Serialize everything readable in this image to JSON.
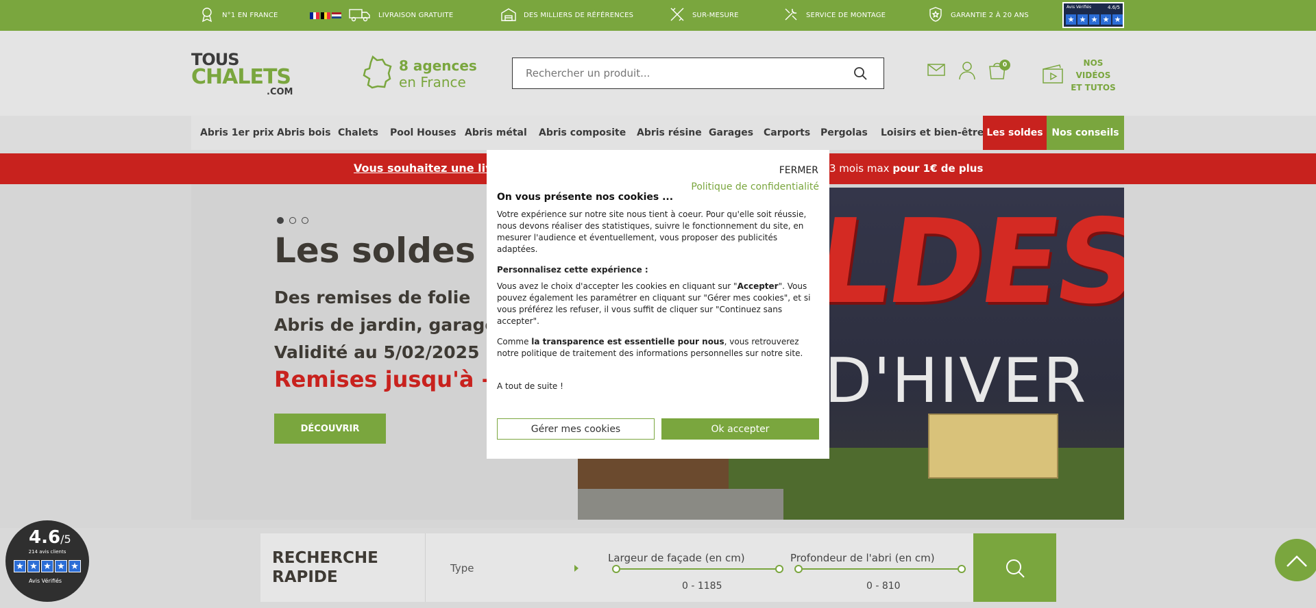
{
  "topbar": {
    "items": [
      {
        "label": "N°1 EN FRANCE",
        "icon": "ribbon-icon"
      },
      {
        "label": "LIVRAISON GRATUITE",
        "icon": "truck-icon"
      },
      {
        "label": "DES MILLIERS DE RÉFÉRENCES",
        "icon": "warehouse-icon"
      },
      {
        "label": "SUR-MESURE",
        "icon": "ruler-pencil-icon"
      },
      {
        "label": "SERVICE DE MONTAGE",
        "icon": "tools-icon"
      },
      {
        "label": "GARANTIE 2 À 20 ANS",
        "icon": "shield-star-icon"
      }
    ],
    "avis_label": "Avis Vérifiés",
    "avis_rating": "4.6/5",
    "color": "#7aa63e"
  },
  "header": {
    "logo_line1": "TOUS",
    "logo_line2": "CHALETS",
    "logo_line3": ".COM",
    "agences_bold": "8 agences",
    "agences_sub": "en France",
    "search_placeholder": "Rechercher un produit...",
    "cart_count": "0",
    "videos_label": "NOS VIDÉOS ET TUTOS"
  },
  "nav": {
    "items": [
      "Abris 1er prix",
      "Abris bois",
      "Chalets",
      "Pool Houses",
      "Abris métal",
      "Abris composite",
      "Abris résine",
      "Garages",
      "Carports",
      "Pergolas",
      "Loisirs et bien-être",
      "Les soldes",
      "Nos conseils"
    ]
  },
  "banner": {
    "left_text": "Vous souhaitez une livr",
    "right_text": "3 mois max",
    "right_bold": "pour 1€ de plus",
    "color": "#c8221e"
  },
  "hero": {
    "title": "Les soldes d'h",
    "line1": "Des remises de folie",
    "line2": "Abris de jardin, garages,",
    "line3": "Validité au 5/02/2025 inc",
    "promo": "Remises jusqu'à -60",
    "cta": "DÉCOUVRIR",
    "image_text1": "LDES",
    "image_text2": "D'HIVER",
    "slide_count": 3,
    "active_slide": 1
  },
  "cookie_modal": {
    "close_label": "FERMER",
    "policy_link": "Politique de confidentialité",
    "title": "On vous présente nos cookies ...",
    "p1": "Votre expérience sur notre site nous tient à coeur. Pour qu'elle soit réussie, nous devons réaliser des statistiques, suivre le fonctionnement du site, en mesurer l'audience et éventuellement, vous proposer des publicités adaptées.",
    "p2_title": "Personnalisez cette expérience :",
    "p3_a": "Vous avez le choix d'accepter les cookies en cliquant sur \"",
    "p3_bold": "Accepter",
    "p3_b": "\". Vous pouvez également les paramétrer en cliquant sur \"Gérer mes cookies\", et si vous préférez les refuser, il vous suffit de cliquer sur \"Continuez sans accepter\".",
    "p4_a": "Comme ",
    "p4_bold": "la transparence est essentielle pour nous",
    "p4_b": ", vous retrouverez notre politique de traitement des informations personnelles sur notre site.",
    "p5": "A tout de suite !",
    "manage_label": "Gérer mes cookies",
    "accept_label": "Ok accepter"
  },
  "quick_search": {
    "title_line1": "RECHERCHE",
    "title_line2": "RAPIDE",
    "type_label": "Type",
    "width_label": "Largeur de façade (en cm)",
    "width_value": "0 - 1185",
    "depth_label": "Profondeur de l'abri (en cm)",
    "depth_value": "0 - 810"
  },
  "rating_badge": {
    "value": "4.6",
    "max": "/5",
    "count": "214 avis clients",
    "brand": "Avis Vérifiés"
  }
}
